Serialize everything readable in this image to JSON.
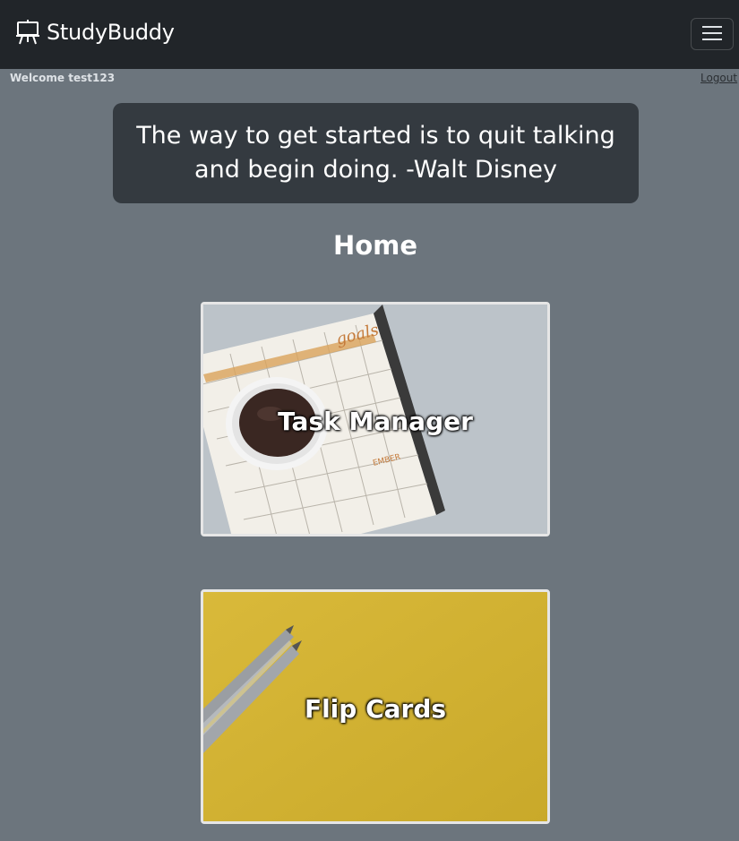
{
  "navbar": {
    "brand": "StudyBuddy",
    "brand_icon": "easel-icon",
    "toggler_icon": "hamburger-menu-icon"
  },
  "user_bar": {
    "welcome": "Welcome test123",
    "logout": "Logout"
  },
  "quote": {
    "text": "The way to get started is to quit talking and begin doing. -Walt Disney"
  },
  "page": {
    "title": "Home"
  },
  "cards": [
    {
      "label": "Task Manager",
      "image": "coffee-planner-photo"
    },
    {
      "label": "Flip Cards",
      "image": "pencils-yellow-photo"
    }
  ],
  "colors": {
    "navbar_bg": "#212529",
    "page_bg": "#6c757d",
    "quote_bg": "#343a40",
    "flip_card_bg": "#d4b630"
  }
}
